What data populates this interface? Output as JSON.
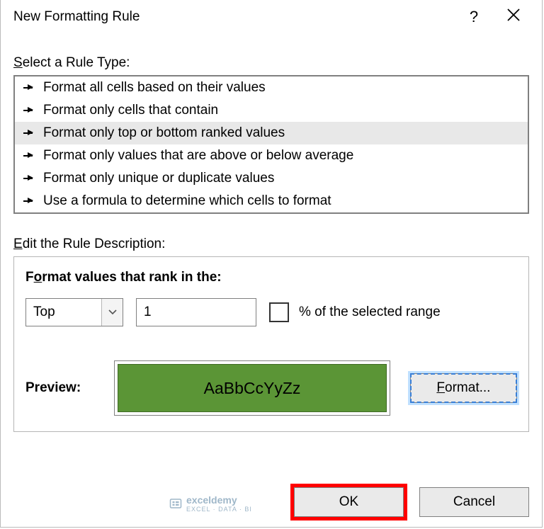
{
  "title": "New Formatting Rule",
  "section_select_label_pre": "S",
  "section_select_label_post": "elect a Rule Type:",
  "rule_types": [
    "Format all cells based on their values",
    "Format only cells that contain",
    "Format only top or bottom ranked values",
    "Format only values that are above or below average",
    "Format only unique or duplicate values",
    "Use a formula to determine which cells to format"
  ],
  "selected_rule_index": 2,
  "edit_label_pre": "E",
  "edit_label_post": "dit the Rule Description:",
  "desc_title_pre": "F",
  "desc_title_mid": "o",
  "desc_title_post": "rmat values that rank in the:",
  "rank_direction": "Top",
  "rank_value": "1",
  "percent_label": "% of the selected range",
  "preview_label": "Preview:",
  "preview_sample": "AaBbCcYyZz",
  "format_button_pre": "F",
  "format_button_post": "ormat...",
  "ok_label": "OK",
  "cancel_label": "Cancel",
  "watermark_name": "exceldemy",
  "watermark_sub": "EXCEL · DATA · BI"
}
